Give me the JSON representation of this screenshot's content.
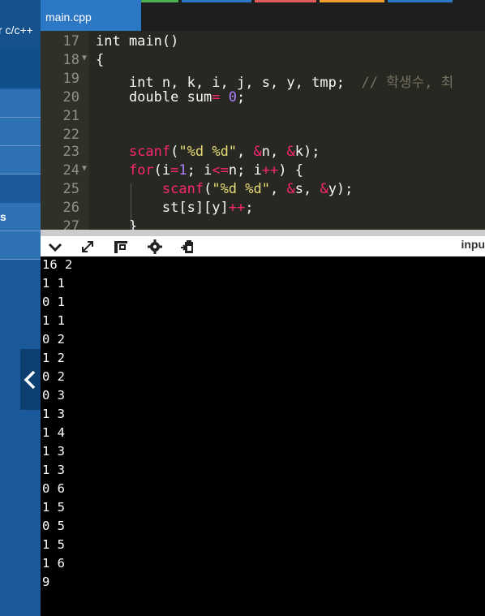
{
  "sidebar": {
    "header_label": "r c/c++",
    "items": [
      {
        "label": ""
      },
      {
        "label": ""
      },
      {
        "label": ""
      },
      {
        "label": "s"
      },
      {
        "label": ""
      }
    ]
  },
  "tabs": [
    {
      "label": "main.cpp"
    }
  ],
  "editor": {
    "line_numbers": [
      "17",
      "18",
      "19",
      "20",
      "21",
      "22",
      "23",
      "24",
      "25",
      "26",
      "27"
    ]
  },
  "toolbar": {
    "input_label": "inpu"
  },
  "output": {
    "lines": [
      "16 2",
      "1 1",
      "0 1",
      "1 1",
      "0 2",
      "1 2",
      "0 2",
      "0 3",
      "1 3",
      "1 4",
      "1 3",
      "1 3",
      "0 6",
      "1 5",
      "0 5",
      "1 5",
      "1 6",
      "9"
    ]
  },
  "colors": {
    "sidebar": "#1b5a9a",
    "tab_active": "#2d78c4",
    "editor_bg": "#272822",
    "keyword": "#f92672",
    "type": "#66d9ef",
    "number": "#ae81ff",
    "string": "#e6db74",
    "comment": "#75715e"
  }
}
